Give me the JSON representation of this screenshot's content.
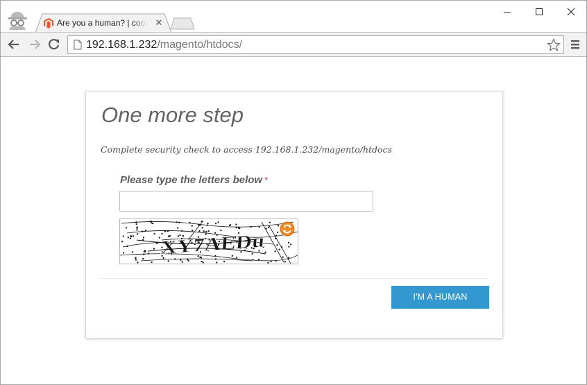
{
  "browser": {
    "tab": {
      "title": "Are you a human? | cool s",
      "close_glyph": "✕"
    },
    "address": {
      "host": "192.168.1.232",
      "path": "/magento/htdocs/"
    },
    "icons": {
      "profile": "incognito-icon",
      "favicon": "magento-logo-icon",
      "back": "back-arrow-icon",
      "forward": "forward-arrow-icon",
      "reload": "reload-icon",
      "page": "page-icon",
      "bookmark": "star-icon",
      "menu": "hamburger-menu-icon"
    }
  },
  "page": {
    "heading": "One more step",
    "subtitle": "Complete security check to access 192.168.1.232/magento/htdocs",
    "field_label": "Please type the letters below",
    "required_mark": "*",
    "captcha_value": "",
    "captcha_text": "XY7AEDu",
    "submit_label": "I'M A HUMAN"
  },
  "colors": {
    "button": "#3398cf",
    "required": "#e03434",
    "favicon": "#e8562a",
    "refresh": "#f08a24"
  }
}
